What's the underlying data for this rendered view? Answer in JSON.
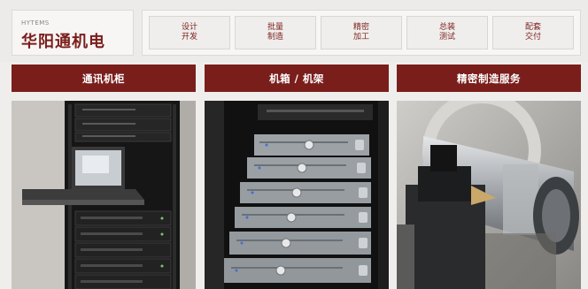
{
  "brand": {
    "en": "HYTEMS",
    "cn": "华阳通机电"
  },
  "nav": [
    {
      "line1": "设计",
      "line2": "开发"
    },
    {
      "line1": "批量",
      "line2": "制造"
    },
    {
      "line1": "精密",
      "line2": "加工"
    },
    {
      "line1": "总装",
      "line2": "测试"
    },
    {
      "line1": "配套",
      "line2": "交付"
    }
  ],
  "cards": [
    {
      "title": "通讯机柜",
      "image": "server-rack-cabinet-photo"
    },
    {
      "title": "机箱 / 机架",
      "image": "rackmount-chassis-photo"
    },
    {
      "title": "精密制造服务",
      "image": "precision-machining-photo"
    }
  ],
  "colors": {
    "accent": "#7a1e1c",
    "background": "#efeeec",
    "panel": "#f7f6f4"
  }
}
